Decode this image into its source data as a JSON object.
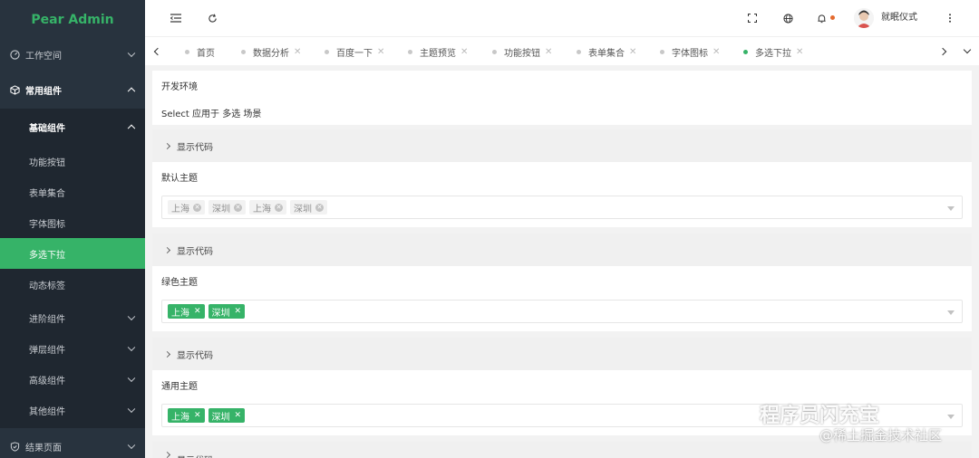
{
  "app": {
    "logo": "Pear Admin"
  },
  "sidebar": {
    "workspace": "工作空间",
    "common": "常用组件",
    "basic": "基础组件",
    "sub": [
      "功能按钮",
      "表单集合",
      "字体图标",
      "多选下拉",
      "动态标签"
    ],
    "advanced": "进阶组件",
    "popup": "弹层组件",
    "senior": "高级组件",
    "other": "其他组件",
    "result": "结果页面"
  },
  "header": {
    "user": "就眠仪式"
  },
  "tabs": [
    "首页",
    "数据分析",
    "百度一下",
    "主题预览",
    "功能按钮",
    "表单集合",
    "字体图标",
    "多选下拉"
  ],
  "main": {
    "env_title": "开发环境",
    "env_desc": "Select 应用于 多选 场景",
    "show_code": "显示代码",
    "default_theme": "默认主题",
    "default_tags": [
      "上海",
      "深圳",
      "上海",
      "深圳"
    ],
    "green_theme": "绿色主题",
    "green_tags": [
      "上海",
      "深圳"
    ],
    "general_theme": "通用主题",
    "general_tags": [
      "上海",
      "深圳"
    ]
  },
  "watermark": {
    "line1": "程序员闪充宝",
    "line2": "@稀土掘金技术社区"
  },
  "colors": {
    "accent": "#36b368",
    "sidebar_bg": "#28333e",
    "sidebar_sub_bg": "#1f2730",
    "badge": "#e46a2e"
  }
}
